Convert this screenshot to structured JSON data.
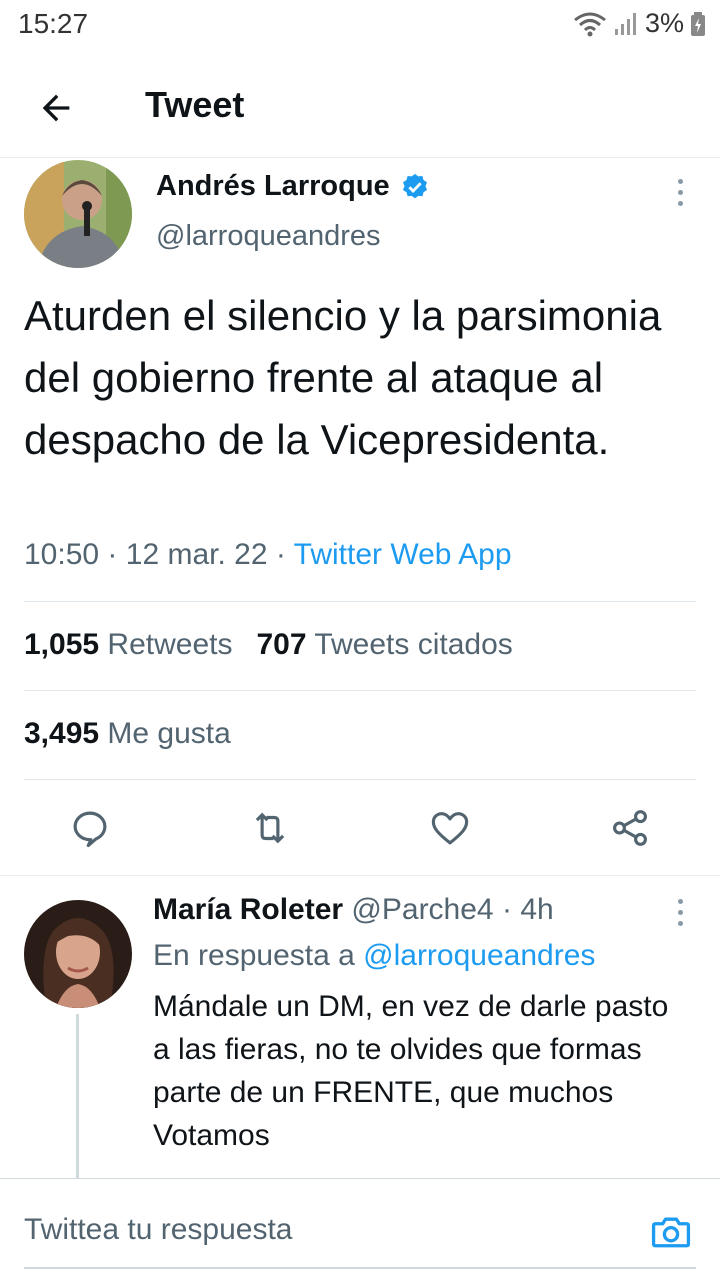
{
  "status_bar": {
    "time": "15:27",
    "battery": "3%"
  },
  "header": {
    "title": "Tweet"
  },
  "tweet": {
    "author_name": "Andrés Larroque",
    "author_handle": "@larroqueandres",
    "text": "Aturden el silencio y la parsimonia del gobierno frente al ataque al despacho de la Vicepresidenta.",
    "time": "10:50",
    "separator": "·",
    "date": "12 mar. 22",
    "source": "Twitter Web App",
    "retweets_count": "1,055",
    "retweets_label": "Retweets",
    "quotes_count": "707",
    "quotes_label": "Tweets citados",
    "likes_count": "3,495",
    "likes_label": "Me gusta",
    "verified_color": "#1d9bf0"
  },
  "actions": [
    {
      "icon": "reply-icon"
    },
    {
      "icon": "retweet-icon"
    },
    {
      "icon": "like-icon"
    },
    {
      "icon": "share-icon"
    }
  ],
  "reply": {
    "author_name": "María Roleter",
    "author_handle": "@Parche4",
    "separator": "·",
    "age": "4h",
    "reply_prefix": "En respuesta a",
    "reply_to": "@larroqueandres",
    "text": "Mándale un DM, en vez de darle pasto a las fieras, no te olvides que formas parte de un FRENTE, que muchos Votamos"
  },
  "compose": {
    "placeholder": "Twittea tu respuesta"
  }
}
